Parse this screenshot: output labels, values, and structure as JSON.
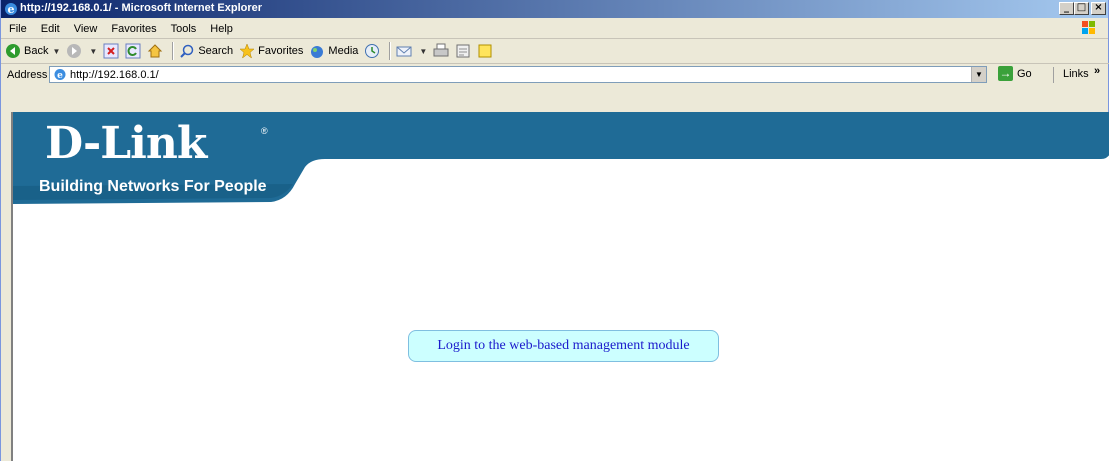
{
  "window": {
    "title": "http://192.168.0.1/ - Microsoft Internet Explorer",
    "caption_buttons": [
      "_",
      "□",
      "×"
    ]
  },
  "menubar": {
    "items": [
      "File",
      "Edit",
      "View",
      "Favorites",
      "Tools",
      "Help"
    ]
  },
  "toolbar": {
    "back_label": "Back",
    "search_label": "Search",
    "favorites_label": "Favorites",
    "media_label": "Media"
  },
  "addressbar": {
    "label": "Address",
    "url": "http://192.168.0.1/",
    "go_label": "Go",
    "links_label": "Links",
    "links_chevron": "»"
  },
  "page": {
    "logo_text": "D-Link",
    "logo_reg": "®",
    "tagline": "Building Networks For People",
    "login_link": "Login to the web-based management module",
    "colors": {
      "banner": "#1f6b96",
      "login_bg": "#ccffff",
      "login_text": "#1a1acc"
    }
  }
}
